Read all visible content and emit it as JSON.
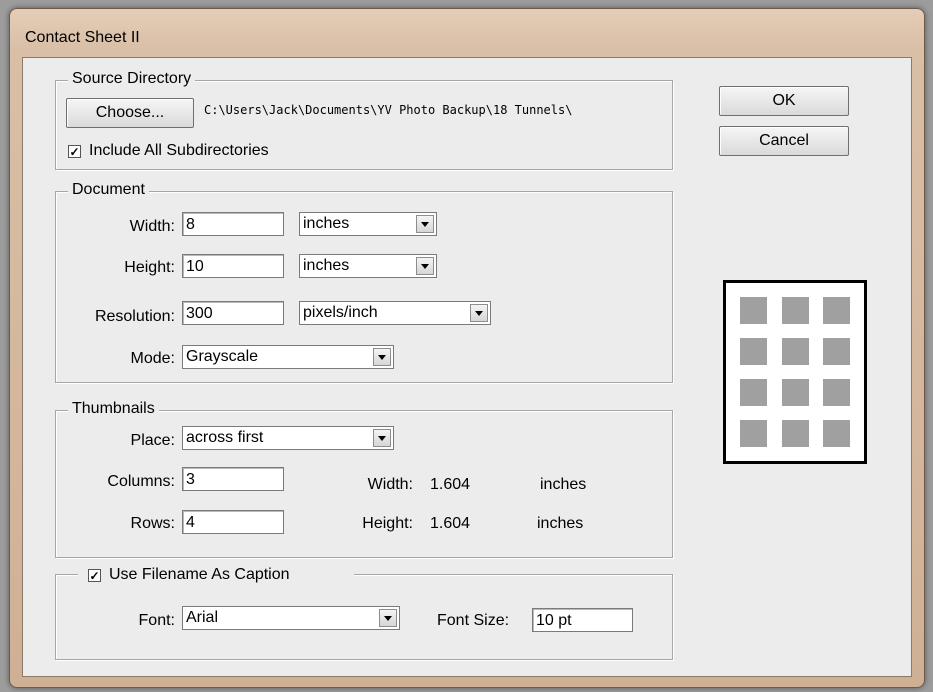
{
  "window": {
    "title": "Contact Sheet II"
  },
  "buttons": {
    "ok": "OK",
    "cancel": "Cancel"
  },
  "source": {
    "legend": "Source Directory",
    "choose_label": "Choose...",
    "path": "C:\\Users\\Jack\\Documents\\YV Photo Backup\\18 Tunnels\\",
    "include_subdirs_label": "Include All Subdirectories",
    "include_subdirs_checked": true
  },
  "document": {
    "legend": "Document",
    "width_label": "Width:",
    "width_value": "8",
    "width_unit": "inches",
    "height_label": "Height:",
    "height_value": "10",
    "height_unit": "inches",
    "resolution_label": "Resolution:",
    "resolution_value": "300",
    "resolution_unit": "pixels/inch",
    "mode_label": "Mode:",
    "mode_value": "Grayscale"
  },
  "thumbnails": {
    "legend": "Thumbnails",
    "place_label": "Place:",
    "place_value": "across first",
    "columns_label": "Columns:",
    "columns_value": "3",
    "rows_label": "Rows:",
    "rows_value": "4",
    "width_label": "Width:",
    "width_value": "1.604",
    "width_unit": "inches",
    "height_label": "Height:",
    "height_value": "1.604",
    "height_unit": "inches"
  },
  "caption": {
    "use_filename_label": "Use Filename As Caption",
    "use_filename_checked": true,
    "font_label": "Font:",
    "font_value": "Arial",
    "font_size_label": "Font Size:",
    "font_size_value": "10 pt"
  },
  "preview": {
    "columns": 3,
    "rows": 4
  }
}
